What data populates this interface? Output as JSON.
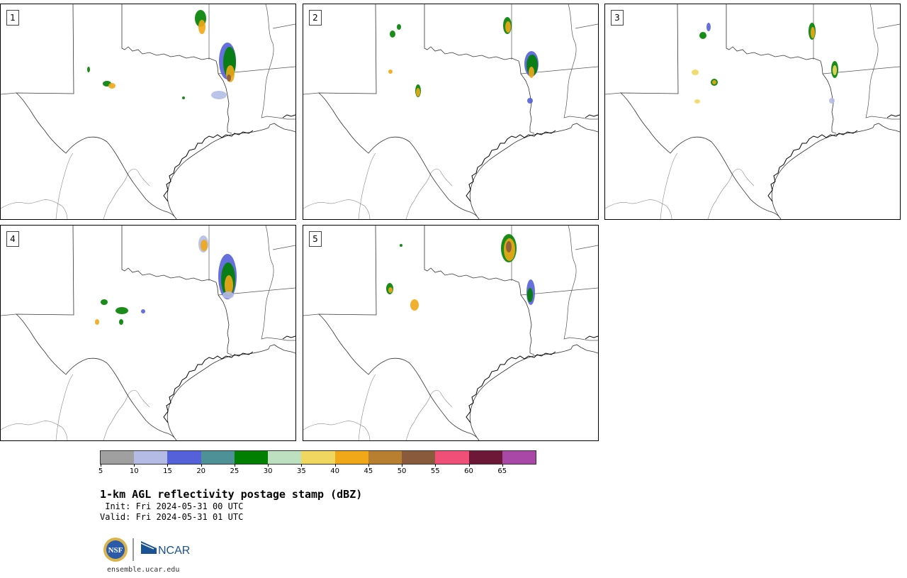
{
  "panels": [
    {
      "label": "1"
    },
    {
      "label": "2"
    },
    {
      "label": "3"
    },
    {
      "label": "4"
    },
    {
      "label": "5"
    }
  ],
  "colorbar": {
    "colors": [
      "#a0a0a0",
      "#b4bce6",
      "#5461d8",
      "#4e9298",
      "#007f00",
      "#bde0c0",
      "#f0d860",
      "#f0a818",
      "#b87f30",
      "#8a5a3c",
      "#f05078",
      "#6e1838",
      "#aa48a8"
    ],
    "ticks": [
      "5",
      "10",
      "15",
      "20",
      "25",
      "30",
      "35",
      "40",
      "45",
      "50",
      "55",
      "60",
      "65"
    ]
  },
  "title": "1-km AGL reflectivity postage stamp (dBZ)",
  "init": " Init: Fri 2024-05-31 00 UTC",
  "valid": "Valid: Fri 2024-05-31 01 UTC",
  "logos": {
    "nsf": "NSF",
    "ncar": "NCAR"
  },
  "website": "ensemble.ucar.edu"
}
